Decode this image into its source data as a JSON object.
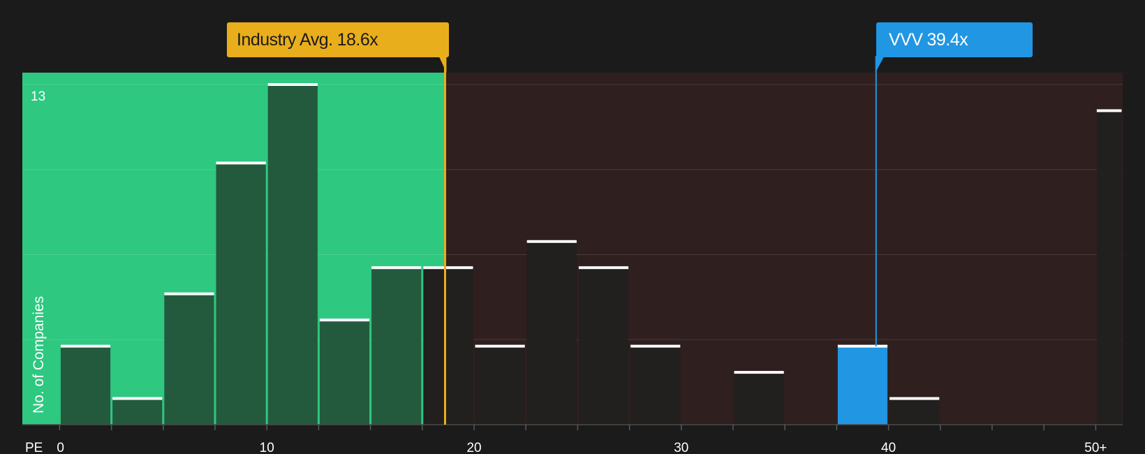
{
  "chart_data": {
    "type": "bar",
    "x_axis_label": "PE",
    "y_axis_label": "No. of Companies",
    "y_max_label": "13",
    "ylim": [
      0,
      13
    ],
    "xlim": [
      -1.8,
      51.3
    ],
    "x_ticks": [
      "0",
      "10",
      "20",
      "30",
      "40",
      "50+"
    ],
    "x_tick_values": [
      0,
      10,
      20,
      30,
      40,
      50
    ],
    "fair_zone_max": 18.6,
    "bins": [
      {
        "start": 0,
        "end": 2.5,
        "value": 3
      },
      {
        "start": 2.5,
        "end": 5,
        "value": 1
      },
      {
        "start": 5,
        "end": 7.5,
        "value": 5
      },
      {
        "start": 7.5,
        "end": 10,
        "value": 10
      },
      {
        "start": 10,
        "end": 12.5,
        "value": 13
      },
      {
        "start": 12.5,
        "end": 15,
        "value": 4
      },
      {
        "start": 15,
        "end": 17.5,
        "value": 6
      },
      {
        "start": 17.5,
        "end": 20,
        "value": 6
      },
      {
        "start": 20,
        "end": 22.5,
        "value": 3
      },
      {
        "start": 22.5,
        "end": 25,
        "value": 7
      },
      {
        "start": 25,
        "end": 27.5,
        "value": 6
      },
      {
        "start": 27.5,
        "end": 30,
        "value": 3
      },
      {
        "start": 32.5,
        "end": 35,
        "value": 2
      },
      {
        "start": 37.5,
        "end": 40,
        "value": 3,
        "highlight": true
      },
      {
        "start": 40,
        "end": 42.5,
        "value": 1
      },
      {
        "start": 50,
        "end": 51.3,
        "value": 12
      }
    ],
    "industry_avg": {
      "label": "Industry Avg.",
      "value_text": "18.6x",
      "value": 18.6
    },
    "company": {
      "label": "VVV",
      "value_text": "39.4x",
      "value": 39.4
    },
    "colors": {
      "background": "#1b1b1b",
      "fair_zone": "#2ec880",
      "expensive_zone": "#2f1f1f",
      "bar_fair": "#235a3e",
      "bar_expensive": "#221f1f",
      "bar_highlight": "#2196e3",
      "bar_top": "#ffffff",
      "industry_line": "#e9ae1c",
      "company_line": "#2196e3",
      "grid": "#4a3a3a",
      "axis_text": "#ffffff"
    }
  }
}
